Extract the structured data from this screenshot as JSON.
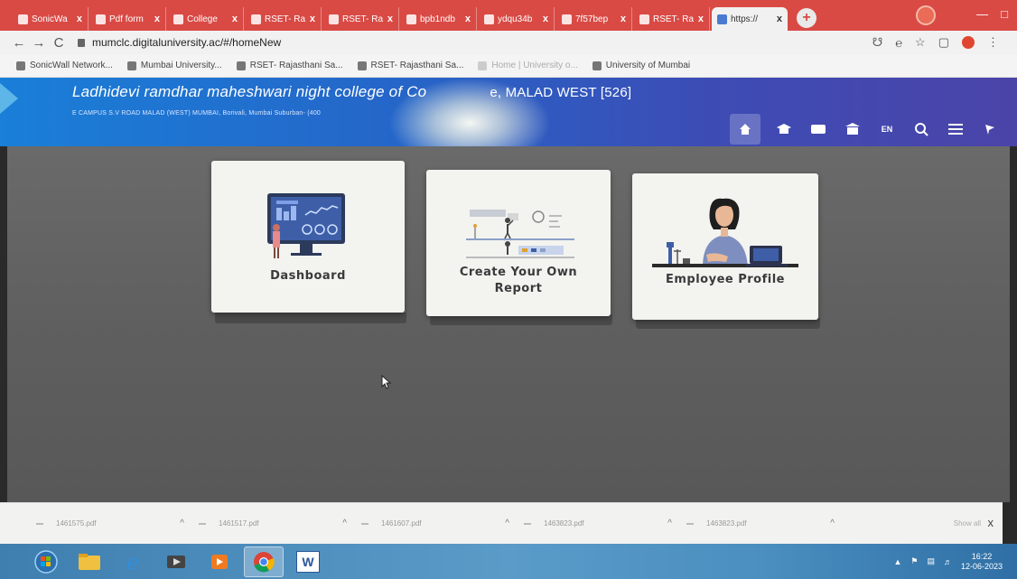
{
  "browser": {
    "tabs": [
      {
        "label": "SonicWa",
        "active": false
      },
      {
        "label": "Pdf form",
        "active": false
      },
      {
        "label": "College",
        "active": false
      },
      {
        "label": "RSET- Ra",
        "active": false
      },
      {
        "label": "RSET- Ra",
        "active": false
      },
      {
        "label": "bpb1ndb",
        "active": false
      },
      {
        "label": "ydqu34b",
        "active": false
      },
      {
        "label": "7f57bep",
        "active": false
      },
      {
        "label": "RSET- Ra",
        "active": false
      },
      {
        "label": "https://",
        "active": true
      }
    ],
    "close_glyph": "x",
    "new_tab_glyph": "+",
    "url": "mumclc.digitaluniversity.ac/#/homeNew",
    "bookmarks": [
      {
        "label": "SonicWall Network...",
        "faded": false
      },
      {
        "label": "Mumbai University...",
        "faded": false
      },
      {
        "label": "RSET- Rajasthani Sa...",
        "faded": false
      },
      {
        "label": "RSET- Rajasthani Sa...",
        "faded": false
      },
      {
        "label": "Home | University o...",
        "faded": true
      },
      {
        "label": "University of Mumbai",
        "faded": false
      }
    ]
  },
  "header": {
    "college_name": "Ladhidevi ramdhar maheshwari night college of Co",
    "college_name_tail": "e, MALAD WEST [526]",
    "address": "E CAMPUS S.V ROAD MALAD (WEST) MUMBAI, Borivali, Mumbai Suburban- (400",
    "lang_label": "EN"
  },
  "cards": [
    {
      "label": "Dashboard",
      "icon": "dashboard-monitor"
    },
    {
      "label": "Create Your Own",
      "label2": "Report",
      "icon": "report-builder"
    },
    {
      "label": "Employee Profile",
      "icon": "employee-at-laptop"
    }
  ],
  "downloads": {
    "items": [
      {
        "file": "1461575.pdf"
      },
      {
        "file": "1461517.pdf"
      },
      {
        "file": "1461607.pdf"
      },
      {
        "file": "1463823.pdf"
      },
      {
        "file": "1463823.pdf"
      }
    ],
    "show_all": "Show all",
    "chevron": "^",
    "close": "x"
  },
  "taskbar": {
    "apps": [
      "start-orb",
      "explorer",
      "internet-explorer",
      "media",
      "player",
      "chrome",
      "word"
    ],
    "word_label": "W",
    "time": "16:22",
    "date": "12-06-2023"
  },
  "colors": {
    "tab_strip": "#d94a45",
    "header_gradient_start": "#1a7fd8",
    "header_gradient_end": "#4b44a8",
    "main_bg": "#636363",
    "card_bg": "#f3f3f0"
  }
}
